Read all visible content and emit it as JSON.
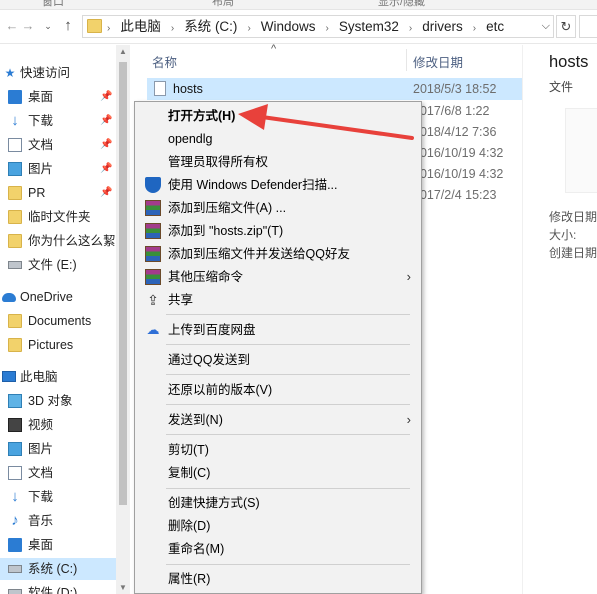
{
  "ribbon": {
    "tabs": [
      "窗口",
      "布局",
      "显示/隐藏"
    ]
  },
  "address": {
    "crumbs": [
      "此电脑",
      "系统 (C:)",
      "Windows",
      "System32",
      "drivers",
      "etc"
    ],
    "back_icon": "back-arrow-icon",
    "forward_icon": "forward-arrow-icon",
    "recent_icon": "chevron-down-icon",
    "up_icon": "up-arrow-icon",
    "refresh_icon": "refresh-icon"
  },
  "sidebar": {
    "items": [
      {
        "label": "快速访问",
        "icon": "star-icon"
      },
      {
        "label": "桌面",
        "icon": "desktop-icon"
      },
      {
        "label": "下载",
        "icon": "download-icon"
      },
      {
        "label": "文档",
        "icon": "documents-icon"
      },
      {
        "label": "图片",
        "icon": "pictures-icon"
      },
      {
        "label": "PR",
        "icon": "folder-icon"
      },
      {
        "label": "临时文件夹",
        "icon": "folder-icon"
      },
      {
        "label": "你为什么这么絜",
        "icon": "folder-icon"
      },
      {
        "label": "文件 (E:)",
        "icon": "drive-icon"
      },
      {
        "label": "OneDrive",
        "icon": "cloud-icon"
      },
      {
        "label": "Documents",
        "icon": "folder-icon"
      },
      {
        "label": "Pictures",
        "icon": "folder-icon"
      },
      {
        "label": "此电脑",
        "icon": "computer-icon"
      },
      {
        "label": "3D 对象",
        "icon": "3d-objects-icon"
      },
      {
        "label": "视频",
        "icon": "videos-icon"
      },
      {
        "label": "图片",
        "icon": "pictures-icon"
      },
      {
        "label": "文档",
        "icon": "documents-icon"
      },
      {
        "label": "下载",
        "icon": "download-icon"
      },
      {
        "label": "音乐",
        "icon": "music-icon"
      },
      {
        "label": "桌面",
        "icon": "desktop-icon"
      },
      {
        "label": "系统 (C:)",
        "icon": "system-drive-icon"
      },
      {
        "label": "软件 (D:)",
        "icon": "drive-icon"
      }
    ]
  },
  "filelist": {
    "columns": {
      "name": "名称",
      "date": "修改日期"
    },
    "rows": [
      {
        "name": "hosts",
        "date": "2018/5/3 18:52"
      },
      {
        "name": "",
        "date": "2017/6/8 1:22"
      },
      {
        "name": "",
        "date": "2018/4/12 7:36"
      },
      {
        "name": "",
        "date": "2016/10/19 4:32"
      },
      {
        "name": "",
        "date": "2016/10/19 4:32"
      },
      {
        "name": "",
        "date": "2017/2/4 15:23"
      }
    ]
  },
  "details": {
    "title": "hosts",
    "type": "文件",
    "props": [
      "修改日期",
      "大小:",
      "创建日期"
    ]
  },
  "menu": {
    "items": [
      {
        "label": "打开方式(H)",
        "bold": true
      },
      {
        "label": "opendlg"
      },
      {
        "label": "管理员取得所有权"
      },
      {
        "label": "使用 Windows Defender扫描...",
        "icon": "windows-defender-icon"
      },
      {
        "label": "添加到压缩文件(A) ...",
        "icon": "winrar-icon"
      },
      {
        "label": "添加到 \"hosts.zip\"(T)",
        "icon": "winrar-icon"
      },
      {
        "label": "添加到压缩文件并发送给QQ好友",
        "icon": "winrar-icon"
      },
      {
        "label": "其他压缩命令",
        "icon": "winrar-icon",
        "submenu": true
      },
      {
        "label": "共享",
        "icon": "share-icon"
      },
      {
        "label": "上传到百度网盘",
        "icon": "baidu-netdisk-icon"
      },
      {
        "label": "通过QQ发送到"
      },
      {
        "label": "还原以前的版本(V)"
      },
      {
        "label": "发送到(N)",
        "submenu": true
      },
      {
        "label": "剪切(T)"
      },
      {
        "label": "复制(C)"
      },
      {
        "label": "创建快捷方式(S)"
      },
      {
        "label": "删除(D)"
      },
      {
        "label": "重命名(M)"
      },
      {
        "label": "属性(R)"
      }
    ]
  },
  "colors": {
    "selection": "#cce8ff",
    "annotation_arrow": "#e8413b",
    "accent": "#2b7cd3"
  }
}
